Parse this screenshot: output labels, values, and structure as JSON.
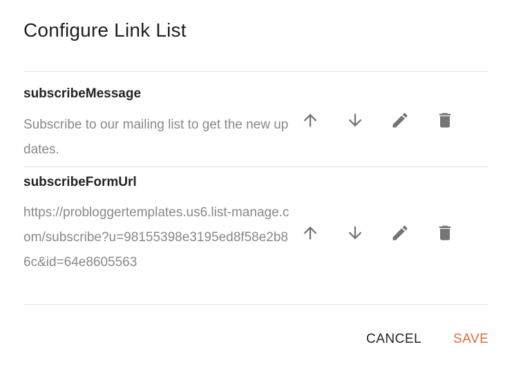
{
  "dialog": {
    "title": "Configure Link List",
    "items": [
      {
        "key": "subscribeMessage",
        "value": "Subscribe to our mailing list to get the new updates."
      },
      {
        "key": "subscribeFormUrl",
        "value": "https://probloggertemplates.us6.list-manage.com/subscribe?u=98155398e3195ed8f58e2b86c&id=64e8605563"
      }
    ],
    "icons": [
      "arrow-up-icon",
      "arrow-down-icon",
      "pencil-icon",
      "trash-icon"
    ],
    "cancel_label": "CANCEL",
    "save_label": "SAVE"
  },
  "colors": {
    "accent": "#e06d35",
    "icon": "#757575",
    "divider": "#e0e0e0",
    "muted_text": "#888888"
  }
}
